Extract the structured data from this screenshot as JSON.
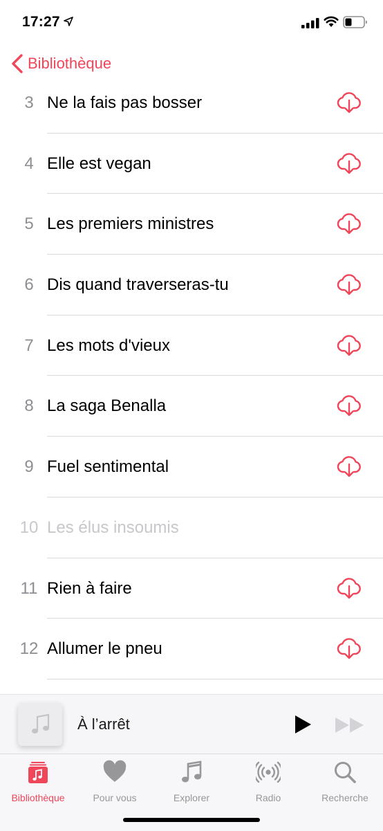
{
  "status_bar": {
    "time": "17:27"
  },
  "nav": {
    "back_label": "Bibliothèque"
  },
  "tracks": [
    {
      "number": "3",
      "title": "Ne la fais pas bosser",
      "available": true
    },
    {
      "number": "4",
      "title": "Elle est vegan",
      "available": true
    },
    {
      "number": "5",
      "title": "Les premiers ministres",
      "available": true
    },
    {
      "number": "6",
      "title": "Dis quand traverseras-tu",
      "available": true
    },
    {
      "number": "7",
      "title": "Les mots d'vieux",
      "available": true
    },
    {
      "number": "8",
      "title": "La saga Benalla",
      "available": true
    },
    {
      "number": "9",
      "title": "Fuel sentimental",
      "available": true
    },
    {
      "number": "10",
      "title": "Les élus insoumis",
      "available": false
    },
    {
      "number": "11",
      "title": "Rien à faire",
      "available": true
    },
    {
      "number": "12",
      "title": "Allumer le pneu",
      "available": true
    }
  ],
  "mini_player": {
    "status": "À l’arrêt"
  },
  "tabs": [
    {
      "label": "Bibliothèque",
      "icon": "library-icon",
      "active": true
    },
    {
      "label": "Pour vous",
      "icon": "heart-icon",
      "active": false
    },
    {
      "label": "Explorer",
      "icon": "music-note-icon",
      "active": false
    },
    {
      "label": "Radio",
      "icon": "radio-icon",
      "active": false
    },
    {
      "label": "Recherche",
      "icon": "search-icon",
      "active": false
    }
  ],
  "colors": {
    "accent": "#f0465a",
    "disabled_text": "#c7c7cc",
    "track_number": "#8e8e93",
    "tab_inactive": "#979799"
  }
}
